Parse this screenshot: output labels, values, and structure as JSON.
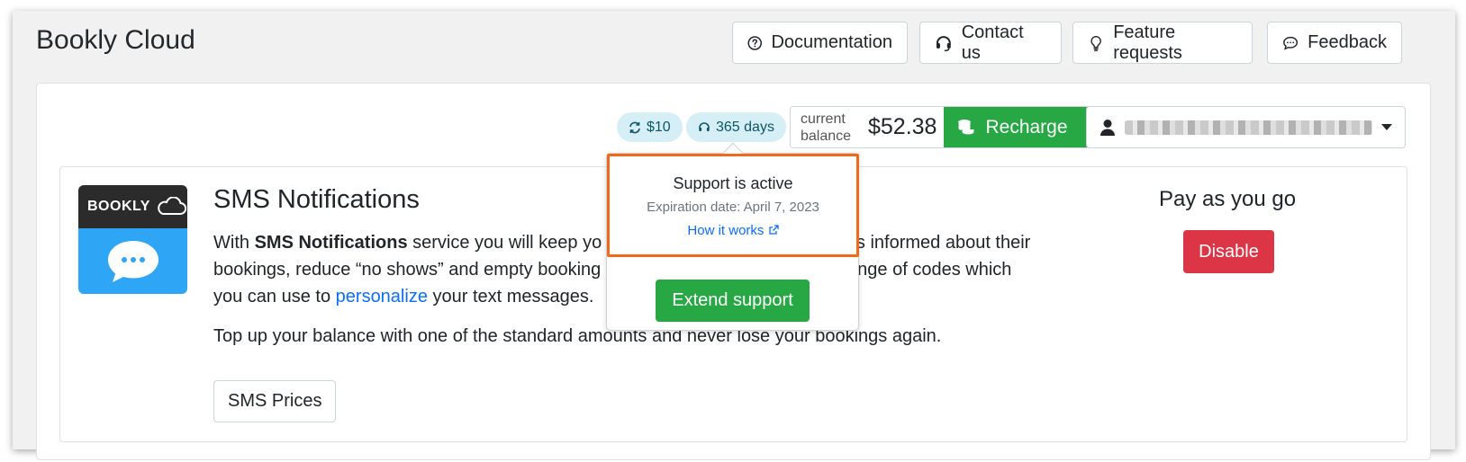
{
  "header": {
    "title": "Bookly Cloud",
    "buttons": {
      "documentation": "Documentation",
      "contact": "Contact us",
      "feature_requests": "Feature requests",
      "feedback": "Feedback"
    }
  },
  "toolbar": {
    "auto_recharge": "$10",
    "support_days": "365 days",
    "balance_label": "current balance",
    "balance_amount": "$52.38",
    "recharge_label": "Recharge"
  },
  "service": {
    "logo_text": "BOOKLY",
    "title": "SMS Notifications",
    "desc_prefix": "With ",
    "desc_bold": "SMS Notifications",
    "desc_mid1": " service you will keep yo",
    "desc_mid2": "rs informed about their",
    "desc_line2a": "bookings, reduce “no shows” and empty booking",
    "desc_line2b": "le range of codes which",
    "desc_line3a": "you can use to ",
    "desc_link": "personalize",
    "desc_line3b": " your text messages.",
    "topup_text": "Top up your balance with one of the standard amounts and never lose your bookings again.",
    "prices_button": "SMS Prices",
    "plan_title": "Pay as you go",
    "disable_button": "Disable"
  },
  "popover": {
    "title": "Support is active",
    "expiration": "Expiration date: April 7, 2023",
    "link": "How it works",
    "extend_button": "Extend support"
  },
  "colors": {
    "accent_green": "#28a745",
    "danger_red": "#dc3545",
    "link_blue": "#0d6efd",
    "highlight_orange": "#f06a1b",
    "pill_bg": "#d6eef5"
  },
  "icons": [
    "question-circle-icon",
    "headset-icon",
    "lightbulb-icon",
    "chat-icon",
    "refresh-icon",
    "coins-icon",
    "user-icon",
    "cloud-icon",
    "speech-bubble-icon",
    "external-link-icon"
  ]
}
